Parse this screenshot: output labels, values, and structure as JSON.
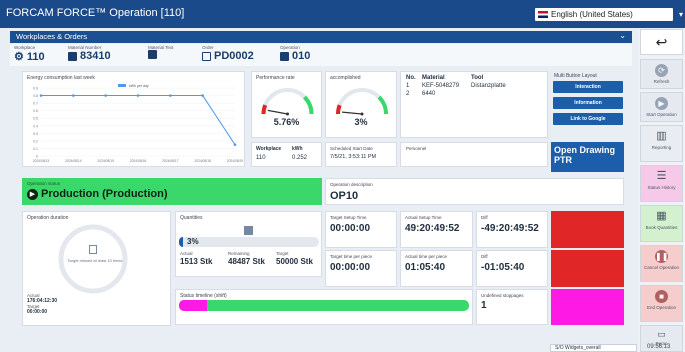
{
  "window": {
    "title": "FORCAM FORCE™ Operation [110]"
  },
  "language": {
    "selected": "English (United States)"
  },
  "header": {
    "section": "Workplaces & Orders"
  },
  "info": {
    "workplace_label": "Workplace",
    "workplace": "110",
    "material_number_label": "Material Number",
    "material_number": "83410",
    "material_text_label": "Material Text",
    "material_text": "",
    "order_label": "Order",
    "order": "PD0002",
    "operation_label": "Operation",
    "operation": "010"
  },
  "energy": {
    "title": "Energy consumption last week",
    "legend": "kWh per day",
    "y_ticks": [
      "0.9",
      "0.8",
      "0.7",
      "0.6",
      "0.5",
      "0.4",
      "0.3",
      "0.2",
      "0.1",
      "0"
    ],
    "x_ticks": [
      "2024/08/13",
      "2024/08/14",
      "2024/08/15",
      "2024/08/16",
      "2024/08/17",
      "2024/08/18",
      "2024/08/19"
    ]
  },
  "chart_data": {
    "type": "line",
    "title": "Energy consumption last week",
    "categories": [
      "2024/08/13",
      "2024/08/14",
      "2024/08/15",
      "2024/08/16",
      "2024/08/17",
      "2024/08/18",
      "2024/08/19"
    ],
    "series": [
      {
        "name": "kWh per day",
        "values": [
          0.8,
          0.8,
          0.8,
          0.8,
          0.8,
          0.8,
          0.15
        ]
      }
    ],
    "ylim": [
      0,
      0.9
    ]
  },
  "performance": {
    "title": "Performance rate",
    "value": "5.76%",
    "fraction": 0.0576
  },
  "accomplished": {
    "title": "accomplished",
    "value": "3%",
    "fraction": 0.03
  },
  "workplace_kwh": {
    "workplace_label": "Workplace",
    "kwh_label": "kWh",
    "workplace": "110",
    "kwh": "0.252"
  },
  "schedule": {
    "label": "Scheduled Start Date",
    "value": "7/5/21, 3:53:11 PM"
  },
  "materials": {
    "headers": [
      "No.",
      "Material",
      "Tool"
    ],
    "rows": [
      {
        "no": "1",
        "material": "KEF-5048279",
        "tool": "Distanzplatte"
      },
      {
        "no": "2",
        "material": "6440",
        "tool": ""
      }
    ]
  },
  "personnel": {
    "label": "Personnel"
  },
  "multi": {
    "title": "Multi Button Layout",
    "buttons": [
      "Interaction",
      "Information",
      "Link to Google"
    ]
  },
  "drawing": {
    "label": "Open Drawing PTR"
  },
  "op_status": {
    "label": "Operation status",
    "value": "Production (Production)"
  },
  "op_desc": {
    "label": "Operation description",
    "value": "OP10"
  },
  "duration": {
    "title": "Operation duration",
    "note": "Target missed at least 10 times",
    "actual_label": "Actual",
    "actual": "176:04:12:30",
    "target_label": "Target",
    "target": "00:00:00"
  },
  "quantities": {
    "title": "Quantities",
    "percent": "3%",
    "fraction": 0.03,
    "actual_label": "Actual",
    "actual": "1513 Stk",
    "remaining_label": "Remaining",
    "remaining": "48487 Stk",
    "target_label": "Target",
    "target": "50000 Stk"
  },
  "times": {
    "target_setup_label": "Target Setup Time",
    "target_setup": "00:00:00",
    "actual_setup_label": "Actual Setup Time",
    "actual_setup": "49:20:49:52",
    "diff1_label": "Diff",
    "diff1": "-49:20:49:52",
    "target_piece_label": "Target time per piece",
    "target_piece": "00:00:00",
    "actual_piece_label": "Actual time per piece",
    "actual_piece": "01:05:40",
    "diff2_label": "Diff",
    "diff2": "-01:05:40"
  },
  "timeline": {
    "title": "Status timeline (shift)"
  },
  "stoppages": {
    "label": "Undefined stoppages",
    "value": "1"
  },
  "sidebar": {
    "items": [
      "Refresh",
      "Start Operation",
      "Reporting",
      "Status History",
      "Book Quantities",
      "Cancel Operation",
      "End Operation",
      "Demo"
    ]
  },
  "footer": {
    "widgets": "S/O Widgets_overall",
    "time": "09:56:13"
  },
  "colors": {
    "accent": "#1a4a8a",
    "production": "#3ad86b",
    "alert": "#e02626",
    "magenta": "#ff19e4"
  }
}
